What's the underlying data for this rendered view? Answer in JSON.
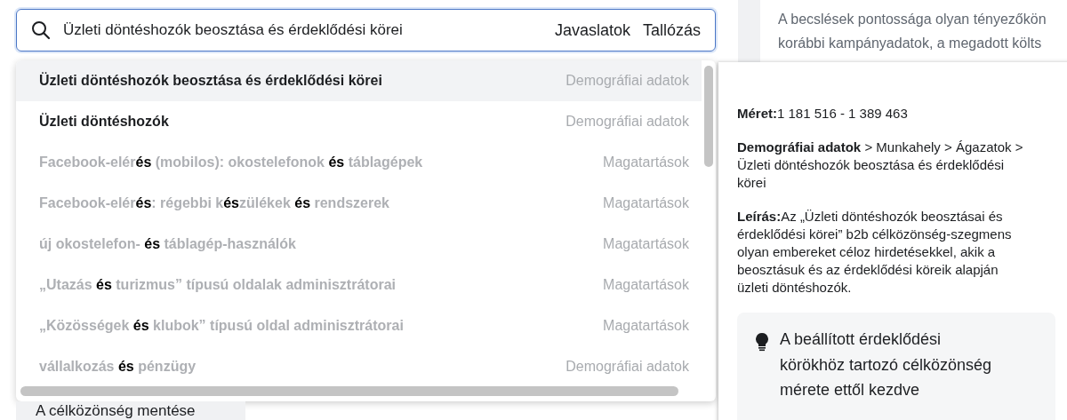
{
  "search": {
    "value": "Üzleti döntéshozók beosztása és érdeklődési körei",
    "actions": [
      {
        "label": "Javaslatok"
      },
      {
        "label": "Tallózás"
      }
    ]
  },
  "suggestions": [
    {
      "selected": true,
      "dimmed": false,
      "segments": [
        {
          "text": "Üzleti döntéshozók beosztása és érdeklődési körei",
          "match": false
        }
      ],
      "category": "Demográfiai adatok"
    },
    {
      "selected": false,
      "dimmed": false,
      "segments": [
        {
          "text": "Üzleti döntéshozók",
          "match": false
        }
      ],
      "category": "Demográfiai adatok"
    },
    {
      "selected": false,
      "dimmed": true,
      "segments": [
        {
          "text": "Facebook-elér",
          "match": false
        },
        {
          "text": "és",
          "match": true
        },
        {
          "text": " (mobilos): okostelefonok ",
          "match": false
        },
        {
          "text": "és",
          "match": true
        },
        {
          "text": " táblagépek",
          "match": false
        }
      ],
      "category": "Magatartások"
    },
    {
      "selected": false,
      "dimmed": true,
      "segments": [
        {
          "text": "Facebook-elér",
          "match": false
        },
        {
          "text": "és",
          "match": true
        },
        {
          "text": ": régebbi k",
          "match": false
        },
        {
          "text": "és",
          "match": true
        },
        {
          "text": "zülékek ",
          "match": false
        },
        {
          "text": "és",
          "match": true
        },
        {
          "text": " rendszerek",
          "match": false
        }
      ],
      "category": "Magatartások"
    },
    {
      "selected": false,
      "dimmed": true,
      "segments": [
        {
          "text": "új okostelefon- ",
          "match": false
        },
        {
          "text": "és",
          "match": true
        },
        {
          "text": " táblagép-használók",
          "match": false
        }
      ],
      "category": "Magatartások"
    },
    {
      "selected": false,
      "dimmed": true,
      "segments": [
        {
          "text": "„Utazás ",
          "match": false
        },
        {
          "text": "és",
          "match": true
        },
        {
          "text": " turizmus” típusú oldalak adminisztrátorai",
          "match": false
        }
      ],
      "category": "Magatartások"
    },
    {
      "selected": false,
      "dimmed": true,
      "segments": [
        {
          "text": "„Közösségek ",
          "match": false
        },
        {
          "text": "és",
          "match": true
        },
        {
          "text": " klubok” típusú oldal adminisztrátorai",
          "match": false
        }
      ],
      "category": "Magatartások"
    },
    {
      "selected": false,
      "dimmed": true,
      "segments": [
        {
          "text": "vállalkozás ",
          "match": false
        },
        {
          "text": "és",
          "match": true
        },
        {
          "text": " pénzügy",
          "match": false
        }
      ],
      "category": "Demográfiai adatok"
    }
  ],
  "footer_button": "A célközönség mentése",
  "estimate_note": [
    "A becslések pontossága olyan tényezőkön",
    "korábbi kampányadatok, a megadott költs"
  ],
  "detail": {
    "size": "**Méret:**1 181 516 - 1 389 463",
    "path": "**Demográfiai adatok** > Munkahely > Ágazatok > Üzleti döntéshozók beosztása és érdeklődési körei",
    "description": "**Leírás:**Az „Üzleti döntéshozók beosztásai és érdeklődési körei” b2b célközönség-szegmens olyan embereket céloz hirdetésekkel, akik a beosztásuk és az érdeklődési köreik alapján üzleti döntéshozók.",
    "tip": [
      "A beállított érdeklődési",
      "körökhöz tartozó célközönség",
      "mérete ettől kezdve"
    ]
  }
}
